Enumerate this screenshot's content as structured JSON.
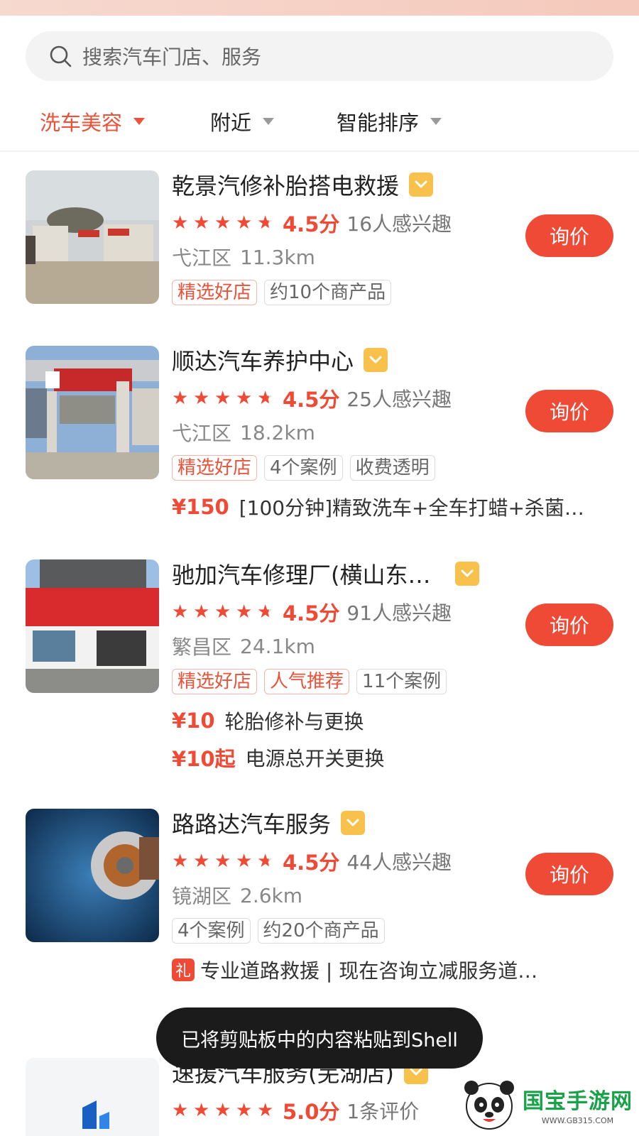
{
  "search": {
    "placeholder": "搜索汽车门店、服务"
  },
  "filters": [
    {
      "label": "洗车美容",
      "active": true
    },
    {
      "label": "附近",
      "active": false
    },
    {
      "label": "智能排序",
      "active": false
    }
  ],
  "shops": [
    {
      "name": "乾景汽修补胎搭电救援",
      "rating": 4.5,
      "score_text": "4.5分",
      "interest": "16人感兴趣",
      "district": "弋江区",
      "distance": "11.3km",
      "tags": [
        "精选好店",
        "约10个商产品"
      ],
      "deals": [],
      "ask_label": "询价"
    },
    {
      "name": "顺达汽车养护中心",
      "rating": 4.5,
      "score_text": "4.5分",
      "interest": "25人感兴趣",
      "district": "弋江区",
      "distance": "18.2km",
      "tags": [
        "精选好店",
        "4个案例",
        "收费透明"
      ],
      "deals": [
        {
          "price": "¥150",
          "desc": "[100分钟]精致洗车+全车打蜡+杀菌…"
        }
      ],
      "ask_label": "询价"
    },
    {
      "name": "驰加汽车修理厂(横山东…",
      "rating": 4.5,
      "score_text": "4.5分",
      "interest": "91人感兴趣",
      "district": "繁昌区",
      "distance": "24.1km",
      "tags": [
        "精选好店",
        "人气推荐",
        "11个案例"
      ],
      "deals": [
        {
          "price": "¥10",
          "desc": "轮胎修补与更换"
        },
        {
          "price": "¥10起",
          "desc": "电源总开关更换"
        }
      ],
      "ask_label": "询价"
    },
    {
      "name": "路路达汽车服务",
      "rating": 4.5,
      "score_text": "4.5分",
      "interest": "44人感兴趣",
      "district": "镜湖区",
      "distance": "2.6km",
      "tags": [
        "4个案例",
        "约20个商产品"
      ],
      "promo": {
        "badge": "礼",
        "text": "专业道路救援 | 现在咨询立减服务道…"
      },
      "ask_label": "询价"
    },
    {
      "name": "速援汽车服务(芜湖店)",
      "rating": 5.0,
      "score_text": "5.0分",
      "interest": "1条评价"
    }
  ],
  "toast": "已将剪贴板中的内容粘贴到Shell",
  "watermark": {
    "name": "国宝手游网",
    "url": "WWW.GB315.COM"
  },
  "colors": {
    "accent": "#ef4a35",
    "badge": "#f7c14b",
    "toast_bg": "#1b1b1b"
  }
}
